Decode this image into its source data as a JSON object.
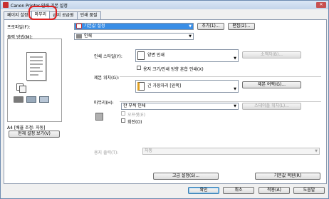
{
  "window": {
    "title": "Canon Printer 인쇄 기본 설정",
    "close_label": "✕"
  },
  "tabs": [
    {
      "label": "페이지 설정"
    },
    {
      "label": "마무리"
    },
    {
      "label": "급지 공급원"
    },
    {
      "label": "인쇄 품질"
    }
  ],
  "profile": {
    "label": "프로파일(F):",
    "value": "기본값 설정",
    "add_label": "추가(1)...",
    "edit_label": "편집(2)..."
  },
  "output": {
    "label": "출력 방법(M):",
    "value": "인쇄"
  },
  "preview": {
    "caption": "A4 [배율 조정: 자동]",
    "view_settings_label": "현재 설정 보기(V)"
  },
  "print_style": {
    "label": "인쇄 스타일(Y):",
    "value": "양면 인쇄",
    "booklet_label": "소책자(B)..."
  },
  "mixed_orientation": {
    "label": "용지 크기/인쇄 방향 혼합 인쇄(X)"
  },
  "binding": {
    "label": "제본 위치(G):",
    "value": "긴 가장자리 [왼쪽]",
    "margin_label": "제본 여백(G)..."
  },
  "finishing": {
    "label": "마무리(H):",
    "value": "한 부씩 인쇄",
    "staple_label": "스테이플 위치(L)...",
    "offset_label": "오프셋(E)",
    "rotate_label": "회전(O)"
  },
  "paper_output": {
    "label": "용지 출력(T):",
    "value": "자동"
  },
  "bottom": {
    "advanced_label": "고급 설정(S)...",
    "restore_label": "기본값 복원(R)"
  },
  "footer": {
    "ok": "확인",
    "cancel": "취소",
    "apply": "적용(A)",
    "help": "도움말"
  }
}
